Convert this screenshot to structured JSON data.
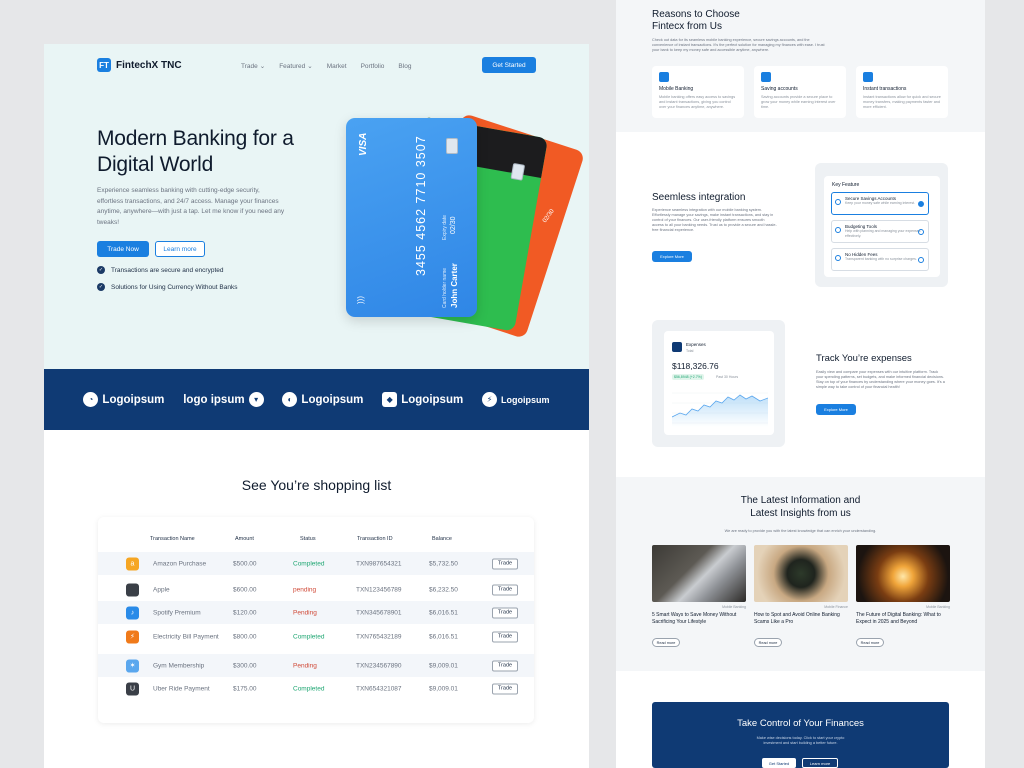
{
  "colors": {
    "primary": "#1a7fe0",
    "navy": "#0f3a74",
    "hero_bg": "#e9f5f5",
    "completed": "#1ea672",
    "pending": "#d04a38"
  },
  "nav": {
    "brand": "FintechX TNC",
    "logo_mark": "FT",
    "links": [
      {
        "label": "Trade",
        "dropdown": true
      },
      {
        "label": "Featured",
        "dropdown": true
      },
      {
        "label": "Market",
        "dropdown": false
      },
      {
        "label": "Portfolio",
        "dropdown": false
      },
      {
        "label": "Blog",
        "dropdown": false
      }
    ],
    "cta": "Get Started"
  },
  "hero": {
    "title": "Modern Banking for a Digital World",
    "description": "Experience seamless banking with cutting-edge security, effortless transactions, and 24/7 access. Manage your finances anytime, anywhere—with just a tap. Let me know if you need any tweaks!",
    "btn_primary": "Trade Now",
    "btn_secondary": "Learn more",
    "bullets": [
      "Transactions are secure and encrypted",
      "Solutions for Using Currency Without Banks"
    ],
    "card": {
      "brand": "VISA",
      "number": "3455 4562 7710 3507",
      "holder_label": "Card holder name",
      "holder": "John Carter",
      "expiry_label": "Expiry date",
      "expiry": "02/30",
      "back_expiry": "02/30"
    }
  },
  "logos": [
    "Logoipsum",
    "logo ipsum",
    "Logoipsum",
    "Logoipsum",
    "Logoipsum"
  ],
  "shopping": {
    "title": "See You’re shopping list",
    "columns": [
      "Transaction Name",
      "Amount",
      "Status",
      "Transaction ID",
      "Balance"
    ],
    "rows": [
      {
        "name": "Amazon Purchase",
        "amount": "$500.00",
        "status": "Completed",
        "id": "TXN987654321",
        "balance": "$5,732.50",
        "action": "Trade",
        "icon": "amazon-icon",
        "color": "#f6a623",
        "glyph": "a"
      },
      {
        "name": "Apple",
        "amount": "$600.00",
        "status": "pending",
        "id": "TXN123456789",
        "balance": "$6,232.50",
        "action": "Trade",
        "icon": "apple-icon",
        "color": "#3a3f47",
        "glyph": ""
      },
      {
        "name": "Spotify Premium",
        "amount": "$120.00",
        "status": "Pending",
        "id": "TXN345678901",
        "balance": "$6,016.51",
        "action": "Trade",
        "icon": "spotify-icon",
        "color": "#2a8be8",
        "glyph": "♪"
      },
      {
        "name": "Electricity Bill Payment",
        "amount": "$800.00",
        "status": "Completed",
        "id": "TXN765432189",
        "balance": "$6,016.51",
        "action": "Trade",
        "icon": "electricity-icon",
        "color": "#f07a1a",
        "glyph": "⚡"
      },
      {
        "name": "Gym Membership",
        "amount": "$300.00",
        "status": "Pending",
        "id": "TXN234567890",
        "balance": "$9,009.01",
        "action": "Trade",
        "icon": "gym-icon",
        "color": "#5aa7ee",
        "glyph": "✶"
      },
      {
        "name": "Uber Ride Payment",
        "amount": "$175.00",
        "status": "Completed",
        "id": "TXN654321087",
        "balance": "$9,009.01",
        "action": "Trade",
        "icon": "uber-icon",
        "color": "#3a3f47",
        "glyph": "U"
      }
    ]
  },
  "reasons": {
    "title_line1": "Reasons to Choose",
    "title_line2": "Fintecx from Us",
    "description": "Check out data for its seamless mobile banking experience, secure savings accounts, and the convenience of instant transactions. It's the perfect solution for managing my finances with ease. I trust your bank to keep my money safe and accessible anytime, anywhere.",
    "cards": [
      {
        "title": "Mobile Banking",
        "desc": "Mobile banking offers easy access to savings and instant transactions, giving you control over your finances anytime, anywhere."
      },
      {
        "title": "Saving accounts",
        "desc": "Saving accounts provide a secure place to grow your money while earning interest over time."
      },
      {
        "title": "Instant transactions",
        "desc": "Instant transactions allow for quick and secure money transfers, making payments faster and more efficient."
      }
    ]
  },
  "integration": {
    "title": "Seemless integration",
    "description": "Experience seamless integration with our mobile banking system. Effortlessly manage your savings, make instant transactions, and stay in control of your finances. Our user-friendly platform ensures smooth access to all your banking needs. Trust us to provide a secure and hassle-free financial experience.",
    "button": "Explore More",
    "key_title": "Key Feature",
    "features": [
      {
        "title": "Secure Savings Accounts",
        "desc": "Keep your money safe while earning interest."
      },
      {
        "title": "Budgeting Tools",
        "desc": "Help with planning and managing your expenses effectively."
      },
      {
        "title": "No Hidden Fees",
        "desc": "Transparent banking with no surprise charges."
      }
    ]
  },
  "expenses": {
    "widget_title": "Expenses",
    "widget_sub": "Total",
    "amount": "$118,326.76",
    "delta": "$56,8948 (+2.7%)",
    "delta_note": "Past 30 Hours",
    "title": "Track You’re expenses",
    "description": "Easily view and compare your expenses with our intuitive platform. Track your spending patterns, set budgets, and make informed financial decisions. Stay on top of your finances by understanding where your money goes. It's a simple way to take control of your financial health!",
    "button": "Explore More"
  },
  "insights": {
    "title_line1": "The Latest Information and",
    "title_line2": "Latest Insights from us",
    "subtitle": "We are ready to provide you with the latest knowledge that can enrich your understanding.",
    "cards": [
      {
        "tag": "Mobile Banking",
        "title": "5 Smart Ways to Save Money Without Sacrificing Your Lifestyle",
        "button": "Read more"
      },
      {
        "tag": "Mobile Finance",
        "title": "How to Spot and Avoid Online Banking Scams Like a Pro",
        "button": "Read more"
      },
      {
        "tag": "Mobile Banking",
        "title": "The Future of Digital Banking: What to Expect in 2025 and Beyond",
        "button": "Read more"
      }
    ]
  },
  "cta": {
    "title": "Take Control of Your Finances",
    "description": "Make wise decisions today. Click to start your crypto investment and start building a better future.",
    "btn1": "Get Started",
    "btn2": "Learn more"
  }
}
